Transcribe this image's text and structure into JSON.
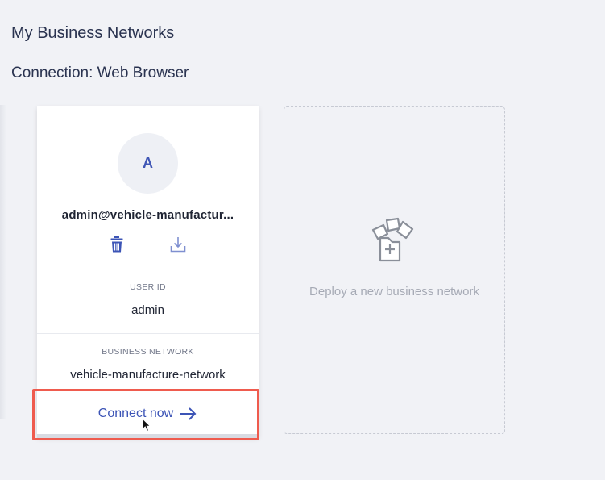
{
  "page": {
    "title": "My Business Networks",
    "connection_label": "Connection: Web Browser"
  },
  "id_card": {
    "avatar_initial": "A",
    "name": "admin@vehicle-manufactur...",
    "user_id_label": "USER ID",
    "user_id": "admin",
    "network_label": "BUSINESS NETWORK",
    "network": "vehicle-manufacture-network",
    "connect_label": "Connect now"
  },
  "deploy_card": {
    "label": "Deploy a new business network"
  },
  "colors": {
    "accent": "#3c54b6",
    "highlight": "#ef5b4e",
    "background": "#f1f2f6",
    "muted": "#a6aab5"
  },
  "icons": {
    "delete": "trash-icon",
    "export": "download-icon",
    "connect": "arrow-right-icon",
    "deploy": "deploy-files-icon"
  }
}
